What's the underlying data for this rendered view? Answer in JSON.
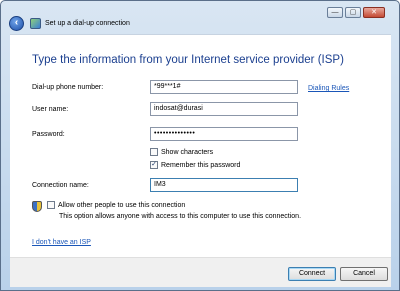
{
  "window": {
    "title": "Set up a dial-up connection",
    "controls": {
      "minimize": "—",
      "maximize": "▢",
      "close": "✕"
    }
  },
  "heading": "Type the information from your Internet service provider (ISP)",
  "form": {
    "phone_label": "Dial-up phone number:",
    "phone_value": "*99***1#",
    "dialing_rules_link": "Dialing Rules",
    "username_label": "User name:",
    "username_value": "indosat@durasi",
    "password_label": "Password:",
    "password_value": "••••••••••••••",
    "show_characters": {
      "label": "Show characters",
      "checked": false
    },
    "remember_password": {
      "label": "Remember this password",
      "checked": true
    },
    "connection_name_label": "Connection name:",
    "connection_name_value": "IM3"
  },
  "allow_others": {
    "label": "Allow other people to use this connection",
    "checked": false,
    "description": "This option allows anyone with access to this computer to use this connection."
  },
  "no_isp_link": "I don't have an ISP",
  "buttons": {
    "connect": "Connect",
    "cancel": "Cancel"
  },
  "colors": {
    "heading": "#1b3f8f",
    "link": "#1a56b8",
    "frame": "#b9d1ea"
  },
  "icons": {
    "back": "back-arrow-icon",
    "title": "dialup-connection-icon",
    "shield": "uac-shield-icon"
  }
}
